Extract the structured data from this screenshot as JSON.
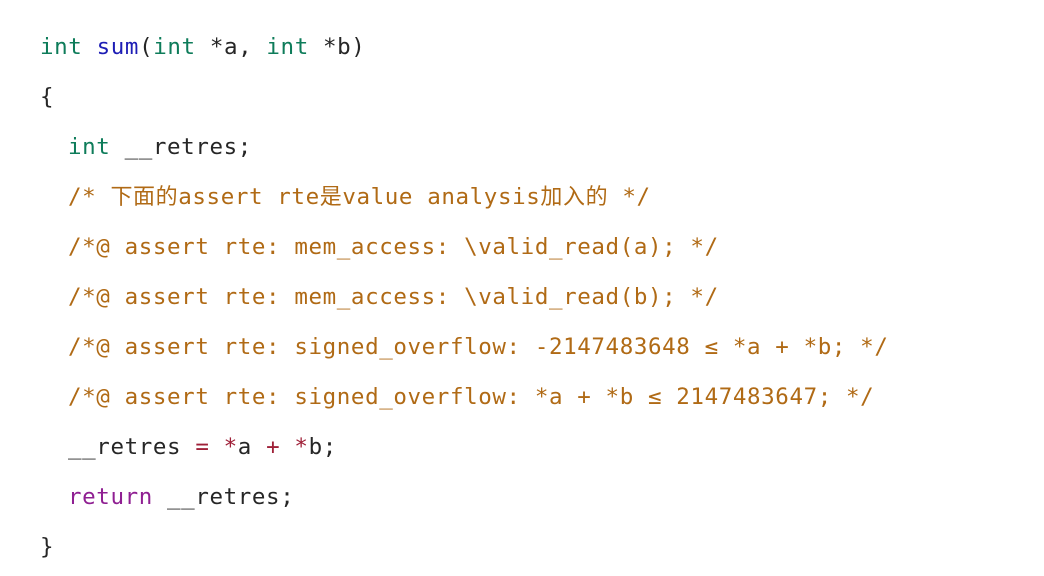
{
  "code": {
    "language": "c",
    "background_color": "#ffffff",
    "colors": {
      "type_keyword": "#0e7c5a",
      "function_name": "#1d1db5",
      "comment": "#b06a15",
      "operator": "#9f2038",
      "control_keyword": "#8f1f92",
      "plain_text": "#262626"
    },
    "lines": [
      {
        "indent": 0,
        "text": "int sum(int *a, int *b)",
        "tokens": [
          {
            "text": "int",
            "type": "type"
          },
          {
            "text": " ",
            "type": "plain"
          },
          {
            "text": "sum",
            "type": "func"
          },
          {
            "text": "(",
            "type": "plain"
          },
          {
            "text": "int",
            "type": "type"
          },
          {
            "text": " *a, ",
            "type": "plain"
          },
          {
            "text": "int",
            "type": "type"
          },
          {
            "text": " *b)",
            "type": "plain"
          }
        ]
      },
      {
        "indent": 0,
        "text": "{",
        "tokens": [
          {
            "text": "{",
            "type": "plain"
          }
        ]
      },
      {
        "indent": 1,
        "text": "int __retres;",
        "tokens": [
          {
            "text": "int",
            "type": "type"
          },
          {
            "text": " __retres;",
            "type": "plain"
          }
        ]
      },
      {
        "indent": 1,
        "text": "/* 下面的assert rte是value analysis加入的 */",
        "tokens": [
          {
            "text": "/* ",
            "type": "comment"
          },
          {
            "text": "下面的",
            "type": "comment-cjk"
          },
          {
            "text": "assert rte",
            "type": "comment"
          },
          {
            "text": "是",
            "type": "comment-cjk"
          },
          {
            "text": "value analysis",
            "type": "comment"
          },
          {
            "text": "加入的",
            "type": "comment-cjk"
          },
          {
            "text": " */",
            "type": "comment"
          }
        ]
      },
      {
        "indent": 1,
        "text": "/*@ assert rte: mem_access: \\valid_read(a); */",
        "tokens": [
          {
            "text": "/*@ assert rte: mem_access: \\valid_read(a); */",
            "type": "comment"
          }
        ]
      },
      {
        "indent": 1,
        "text": "/*@ assert rte: mem_access: \\valid_read(b); */",
        "tokens": [
          {
            "text": "/*@ assert rte: mem_access: \\valid_read(b); */",
            "type": "comment"
          }
        ]
      },
      {
        "indent": 1,
        "text": "/*@ assert rte: signed_overflow: -2147483648 ≤ *a + *b; */",
        "tokens": [
          {
            "text": "/*@ assert rte: signed_overflow: -2147483648 ≤ *a + *b; */",
            "type": "comment"
          }
        ]
      },
      {
        "indent": 1,
        "text": "/*@ assert rte: signed_overflow: *a + *b ≤ 2147483647; */",
        "tokens": [
          {
            "text": "/*@ assert rte: signed_overflow: *a + *b ≤ 2147483647; */",
            "type": "comment"
          }
        ]
      },
      {
        "indent": 1,
        "text": "__retres = *a + *b;",
        "tokens": [
          {
            "text": "__retres ",
            "type": "plain"
          },
          {
            "text": "=",
            "type": "operator"
          },
          {
            "text": " ",
            "type": "plain"
          },
          {
            "text": "*",
            "type": "operator"
          },
          {
            "text": "a ",
            "type": "plain"
          },
          {
            "text": "+",
            "type": "operator"
          },
          {
            "text": " ",
            "type": "plain"
          },
          {
            "text": "*",
            "type": "operator"
          },
          {
            "text": "b;",
            "type": "plain"
          }
        ]
      },
      {
        "indent": 1,
        "text": "return __retres;",
        "tokens": [
          {
            "text": "return",
            "type": "keyword"
          },
          {
            "text": " __retres;",
            "type": "plain"
          }
        ]
      },
      {
        "indent": 0,
        "text": "}",
        "tokens": [
          {
            "text": "}",
            "type": "plain"
          }
        ]
      }
    ]
  }
}
